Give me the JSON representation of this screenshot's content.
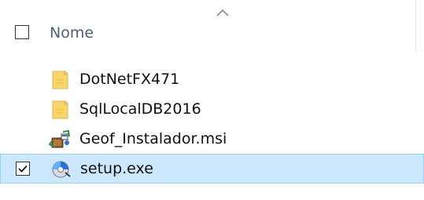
{
  "header": {
    "column_label": "Nome",
    "select_all_checked": false
  },
  "files": [
    {
      "name": "DotNetFX471",
      "icon": "folder-icon",
      "selected": false
    },
    {
      "name": "SqlLocalDB2016",
      "icon": "folder-icon",
      "selected": false
    },
    {
      "name": "Geof_Instalador.msi",
      "icon": "msi-installer-icon",
      "selected": false
    },
    {
      "name": "setup.exe",
      "icon": "setup-exe-icon",
      "selected": true
    }
  ],
  "colors": {
    "selection_background": "#cce8ff",
    "selection_border": "#99d1ff",
    "folder_yellow": "#f8d66a",
    "header_text": "#4c607a"
  }
}
